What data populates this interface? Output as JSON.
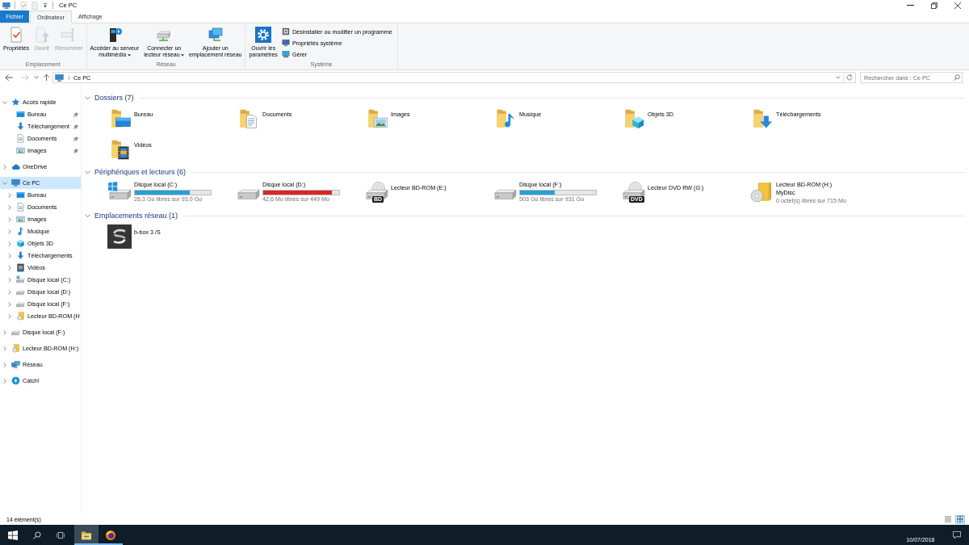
{
  "title_bar": {
    "title": "Ce PC"
  },
  "ribbon_tabs": [
    {
      "label": "Fichier",
      "kind": "menu",
      "selected": false
    },
    {
      "label": "Ordinateur",
      "kind": "tab",
      "selected": true
    },
    {
      "label": "Affichage",
      "kind": "tab",
      "selected": false
    }
  ],
  "ribbon_groups": [
    {
      "label": "Emplacement",
      "buttons": [
        {
          "kind": "large",
          "lines": [
            "Propriétés"
          ],
          "disabled": false,
          "has_menu": false
        },
        {
          "kind": "large",
          "lines": [
            "Ouvrir"
          ],
          "disabled": true,
          "has_menu": false
        },
        {
          "kind": "large",
          "lines": [
            "Renommer"
          ],
          "disabled": true,
          "has_menu": false
        }
      ]
    },
    {
      "label": "Réseau",
      "buttons": [
        {
          "kind": "large",
          "lines": [
            "Accéder au serveur",
            "multimédia"
          ],
          "disabled": false,
          "has_menu": true
        },
        {
          "kind": "large",
          "lines": [
            "Connecter un",
            "lecteur réseau"
          ],
          "disabled": false,
          "has_menu": true
        },
        {
          "kind": "large",
          "lines": [
            "Ajouter un",
            "emplacement réseau"
          ],
          "disabled": false,
          "has_menu": false
        }
      ]
    },
    {
      "label": "Système",
      "buttons": [
        {
          "kind": "large",
          "lines": [
            "Ouvrir les",
            "paramètres"
          ],
          "disabled": false,
          "has_menu": false
        },
        {
          "kind": "small",
          "lines": [
            "Désinstaller ou modifier un programme"
          ],
          "disabled": false,
          "has_menu": false
        },
        {
          "kind": "small",
          "lines": [
            "Propriétés système"
          ],
          "disabled": false,
          "has_menu": false
        },
        {
          "kind": "small",
          "lines": [
            "Gérer"
          ],
          "disabled": false,
          "has_menu": false
        }
      ]
    }
  ],
  "nav_buttons": [
    {
      "kind": "back",
      "disabled": false
    },
    {
      "kind": "forward",
      "disabled": true
    },
    {
      "kind": "recent",
      "disabled": false
    },
    {
      "kind": "up",
      "disabled": false
    }
  ],
  "address_bar": {
    "path": [
      "Ce PC"
    ]
  },
  "search": {
    "placeholder": "Rechercher dans : Ce PC"
  },
  "sidebar": {
    "items": [
      {
        "label": "Accès rapide",
        "expanded": true,
        "selected": false,
        "children": [
          {
            "label": "Bureau",
            "pinned": true,
            "selected": false
          },
          {
            "label": "Téléchargement",
            "pinned": true,
            "selected": false
          },
          {
            "label": "Documents",
            "pinned": true,
            "selected": false
          },
          {
            "label": "Images",
            "pinned": true,
            "selected": false
          }
        ]
      },
      {
        "label": "OneDrive",
        "expanded": false,
        "selected": false
      },
      {
        "label": "Ce PC",
        "expanded": true,
        "selected": true,
        "children": [
          {
            "label": "Bureau",
            "expanded": false,
            "selected": false
          },
          {
            "label": "Documents",
            "expanded": false,
            "selected": false
          },
          {
            "label": "Images",
            "expanded": false,
            "selected": false
          },
          {
            "label": "Musique",
            "expanded": false,
            "selected": false
          },
          {
            "label": "Objets 3D",
            "expanded": false,
            "selected": false
          },
          {
            "label": "Téléchargements",
            "expanded": false,
            "selected": false
          },
          {
            "label": "Vidéos",
            "expanded": false,
            "selected": false
          },
          {
            "label": "Disque local (C:)",
            "expanded": false,
            "selected": false
          },
          {
            "label": "Disque local (D:)",
            "expanded": false,
            "selected": false
          },
          {
            "label": "Disque local (F:)",
            "expanded": false,
            "selected": false
          },
          {
            "label": "Lecteur BD-ROM (H",
            "expanded": false,
            "selected": false
          }
        ]
      },
      {
        "label": "Disque local (F:)",
        "expanded": false,
        "selected": false
      },
      {
        "label": "Lecteur BD-ROM (H:)",
        "expanded": false,
        "selected": false
      },
      {
        "label": "Réseau",
        "expanded": false,
        "selected": false
      },
      {
        "label": "Catch!",
        "expanded": false,
        "selected": false
      }
    ]
  },
  "sections": [
    {
      "title": "Dossiers (7)",
      "kind": "folders",
      "expanded": true,
      "items": [
        {
          "name": "Bureau"
        },
        {
          "name": "Documents"
        },
        {
          "name": "Images"
        },
        {
          "name": "Musique"
        },
        {
          "name": "Objets 3D"
        },
        {
          "name": "Téléchargements"
        },
        {
          "name": "Vidéos"
        }
      ]
    },
    {
      "title": "Périphériques et lecteurs (6)",
      "kind": "drives",
      "expanded": true,
      "items": [
        {
          "name": "Disque local (C:)",
          "level": 0.72,
          "warning": false,
          "detail": "26,3 Go libres sur 93,0 Go"
        },
        {
          "name": "Disque local (D:)",
          "level": 0.9,
          "warning": true,
          "detail": "42,6 Mo libres sur 449 Mo"
        },
        {
          "name": "Lecteur BD-ROM (E:)",
          "badge": "BD"
        },
        {
          "name": "Disque local (F:)",
          "level": 0.46,
          "warning": false,
          "detail": "503 Go libres sur 931 Go"
        },
        {
          "name": "Lecteur DVD RW (G:)",
          "badge": "DVD"
        },
        {
          "name": "Lecteur BD-ROM (H:)",
          "label": "MyDisc",
          "detail": "0 octet(s) libres sur 715 Mo"
        }
      ]
    },
    {
      "title": "Emplacements réseau (1)",
      "kind": "network",
      "expanded": true,
      "items": [
        {
          "name": "b-box 3 /S"
        }
      ]
    }
  ],
  "status_bar": {
    "item_count": "14 élément(s)",
    "view_buttons": [
      {
        "kind": "details",
        "selected": false
      },
      {
        "kind": "large_icons",
        "selected": true
      }
    ]
  },
  "taskbar": {
    "apps": [
      {
        "kind": "explorer",
        "active": true
      },
      {
        "kind": "firefox",
        "active": false
      }
    ],
    "date": "10/07/2018"
  }
}
